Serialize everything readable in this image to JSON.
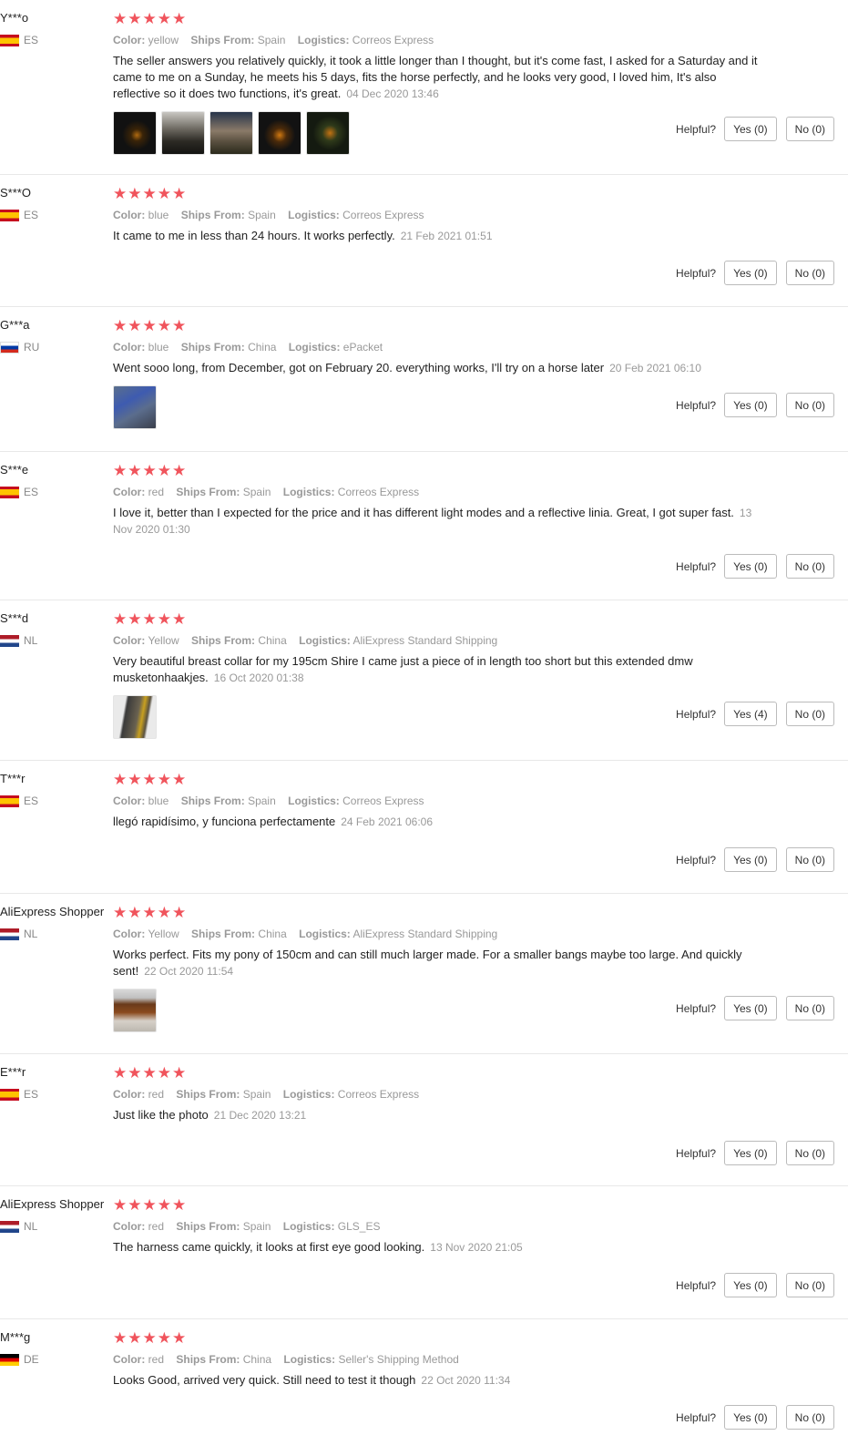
{
  "labels": {
    "color": "Color:",
    "ships_from": "Ships From:",
    "logistics": "Logistics:",
    "helpful": "Helpful?"
  },
  "reviews": [
    {
      "buyer": "Y***o",
      "country": "ES",
      "stars": "★★★★★",
      "color": "yellow",
      "ships_from": "Spain",
      "logistics": "Correos Express",
      "text": "The seller answers you relatively quickly, it took a little longer than I thought, but it's come fast, I asked for a Saturday and it came to me on a Sunday, he meets his 5 days, fits the horse perfectly, and he looks very good, I loved him, It's also reflective so it does two functions, it's great.",
      "date": "04 Dec 2020 13:46",
      "yes": "Yes (0)",
      "no": "No (0)"
    },
    {
      "buyer": "S***O",
      "country": "ES",
      "stars": "★★★★★",
      "color": "blue",
      "ships_from": "Spain",
      "logistics": "Correos Express",
      "text": "It came to me in less than 24 hours. It works perfectly.",
      "date": "21 Feb 2021 01:51",
      "yes": "Yes (0)",
      "no": "No (0)"
    },
    {
      "buyer": "G***a",
      "country": "RU",
      "stars": "★★★★★",
      "color": "blue",
      "ships_from": "China",
      "logistics": "ePacket",
      "text": "Went sooo long, from December, got on February 20. everything works, I'll try on a horse later",
      "date": "20 Feb 2021 06:10",
      "yes": "Yes (0)",
      "no": "No (0)"
    },
    {
      "buyer": "S***e",
      "country": "ES",
      "stars": "★★★★★",
      "color": "red",
      "ships_from": "Spain",
      "logistics": "Correos Express",
      "text": "I love it, better than I expected for the price and it has different light modes and a reflective linia. Great, I got super fast.",
      "date": "13 Nov 2020 01:30",
      "yes": "Yes (0)",
      "no": "No (0)"
    },
    {
      "buyer": "S***d",
      "country": "NL",
      "stars": "★★★★★",
      "color": "Yellow",
      "ships_from": "China",
      "logistics": "AliExpress Standard Shipping",
      "text": "Very beautiful breast collar for my 195cm Shire I came just a piece of in length too short but this extended dmw musketonhaakjes.",
      "date": "16 Oct 2020 01:38",
      "yes": "Yes (4)",
      "no": "No (0)"
    },
    {
      "buyer": "T***r",
      "country": "ES",
      "stars": "★★★★★",
      "color": "blue",
      "ships_from": "Spain",
      "logistics": "Correos Express",
      "text": "llegó rapidísimo, y funciona perfectamente",
      "date": "24 Feb 2021 06:06",
      "yes": "Yes (0)",
      "no": "No (0)"
    },
    {
      "buyer": "AliExpress Shopper",
      "country": "NL",
      "stars": "★★★★★",
      "color": "Yellow",
      "ships_from": "China",
      "logistics": "AliExpress Standard Shipping",
      "text": "Works perfect. Fits my pony of 150cm and can still much larger made. For a smaller bangs maybe too large. And quickly sent!",
      "date": "22 Oct 2020 11:54",
      "yes": "Yes (0)",
      "no": "No (0)"
    },
    {
      "buyer": "E***r",
      "country": "ES",
      "stars": "★★★★★",
      "color": "red",
      "ships_from": "Spain",
      "logistics": "Correos Express",
      "text": "Just like the photo",
      "date": "21 Dec 2020 13:21",
      "yes": "Yes (0)",
      "no": "No (0)"
    },
    {
      "buyer": "AliExpress Shopper",
      "country": "NL",
      "stars": "★★★★★",
      "color": "red",
      "ships_from": "Spain",
      "logistics": "GLS_ES",
      "text": "The harness came quickly, it looks at first eye good looking.",
      "date": "13 Nov 2020 21:05",
      "yes": "Yes (0)",
      "no": "No (0)"
    },
    {
      "buyer": "M***g",
      "country": "DE",
      "stars": "★★★★★",
      "color": "red",
      "ships_from": "China",
      "logistics": "Seller's Shipping Method",
      "text": "Looks Good, arrived very quick. Still need to test it though",
      "date": "22 Oct 2020 11:34",
      "yes": "Yes (0)",
      "no": "No (0)"
    }
  ]
}
